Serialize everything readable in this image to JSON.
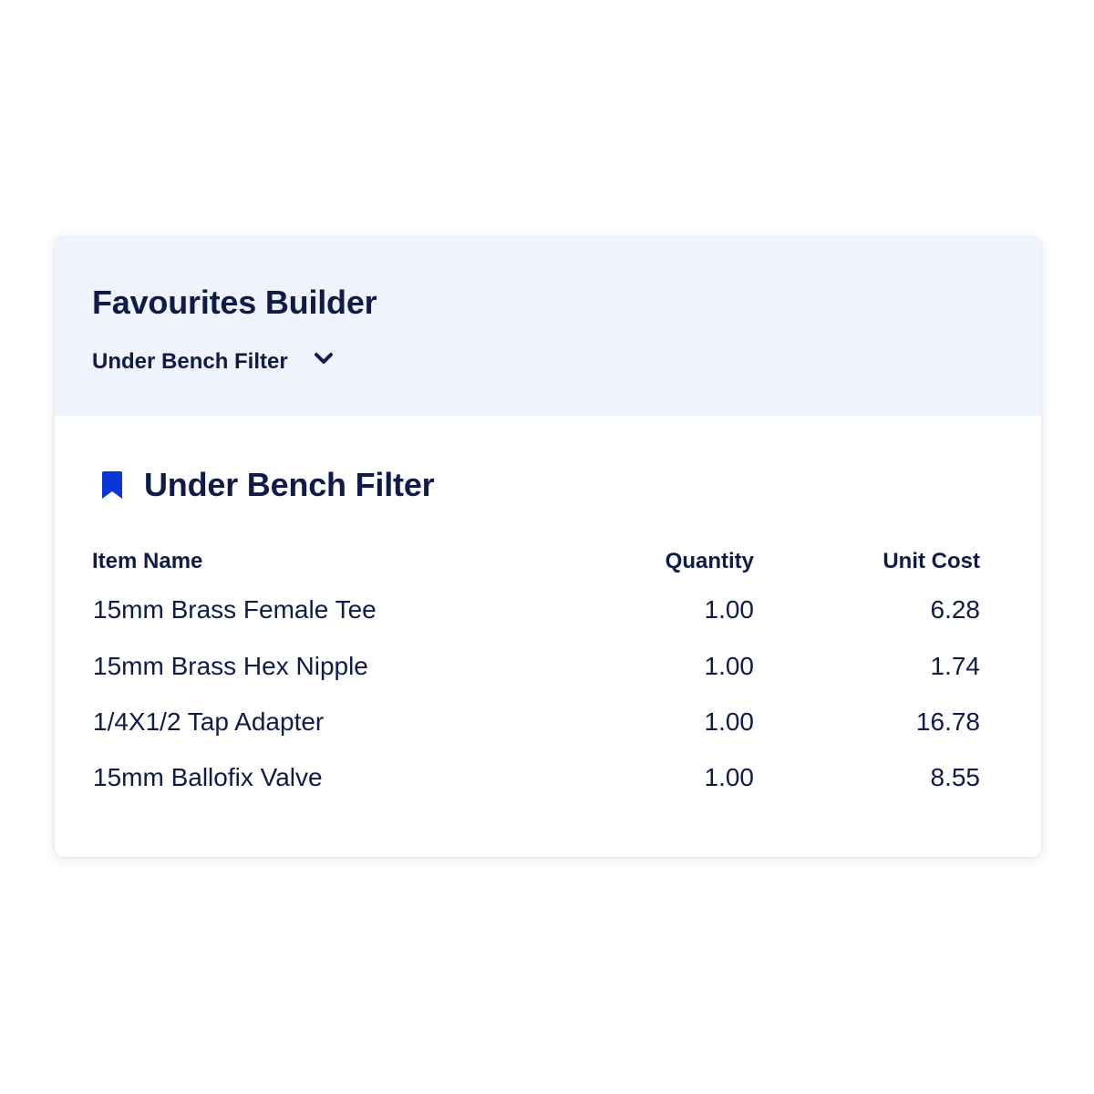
{
  "header": {
    "title": "Favourites Builder",
    "selected_list": "Under Bench Filter",
    "selector_icon": "chevron-down-icon"
  },
  "list": {
    "title": "Under Bench Filter",
    "icon": "bookmark-icon",
    "columns": {
      "name": "Item Name",
      "quantity": "Quantity",
      "unit_cost": "Unit Cost"
    },
    "items": [
      {
        "name": "15mm Brass Female Tee",
        "quantity": "1.00",
        "unit_cost": "6.28"
      },
      {
        "name": "15mm Brass Hex Nipple",
        "quantity": "1.00",
        "unit_cost": "1.74"
      },
      {
        "name": "1/4X1/2 Tap Adapter",
        "quantity": "1.00",
        "unit_cost": "16.78"
      },
      {
        "name": "15mm Ballofix Valve",
        "quantity": "1.00",
        "unit_cost": "8.55"
      }
    ]
  },
  "colors": {
    "text": "#0f1c48",
    "accent": "#0a36d6",
    "header_background": "#eff3fb"
  }
}
